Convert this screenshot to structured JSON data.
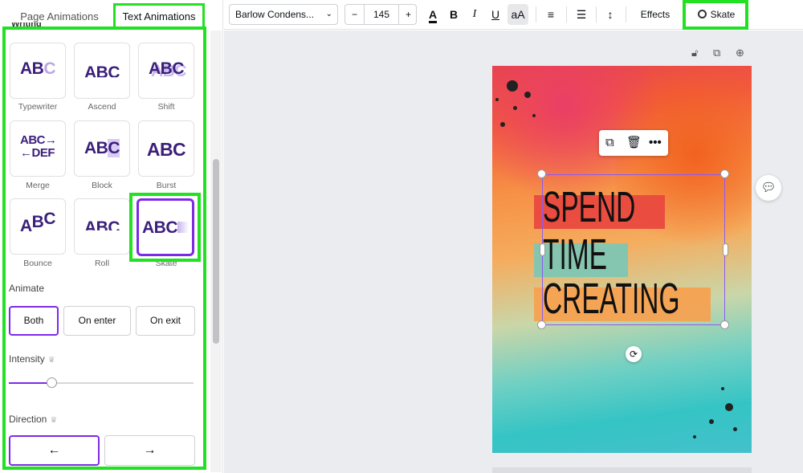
{
  "tabs": {
    "page_animations": "Page Animations",
    "text_animations": "Text Animations"
  },
  "panel": {
    "section_cutoff": "Writing",
    "animations": [
      {
        "label": "Typewriter",
        "preview": "ABC"
      },
      {
        "label": "Ascend",
        "preview": "ABC"
      },
      {
        "label": "Shift",
        "preview": "ABC"
      },
      {
        "label": "Merge",
        "preview": "ABC→ ←DEF"
      },
      {
        "label": "Block",
        "preview": "ABC"
      },
      {
        "label": "Burst",
        "preview": "ABC"
      },
      {
        "label": "Bounce",
        "preview": "ABC"
      },
      {
        "label": "Roll",
        "preview": "ABC"
      },
      {
        "label": "Skate",
        "preview": "ABC"
      }
    ],
    "selected_animation": "Skate",
    "animate_label": "Animate",
    "animate_options": [
      "Both",
      "On enter",
      "On exit"
    ],
    "animate_selected": "Both",
    "intensity_label": "Intensity",
    "intensity_value": 0.23,
    "direction_label": "Direction",
    "direction_left": "←",
    "direction_right": "→"
  },
  "toolbar": {
    "font": "Barlow Condens...",
    "font_size": "145",
    "minus": "−",
    "plus": "+",
    "text_color_icon": "A",
    "bold": "B",
    "italic": "I",
    "underline": "U",
    "case": "aA",
    "effects": "Effects",
    "animate_button": "Skate"
  },
  "canvas": {
    "lines": [
      "SPEND",
      "TIME",
      "CREATING"
    ],
    "bar_colors": [
      "#e8463f",
      "#7cc7b5",
      "#f6a14e"
    ],
    "accent": "#7d2ae8",
    "highlight": "#22e022"
  }
}
